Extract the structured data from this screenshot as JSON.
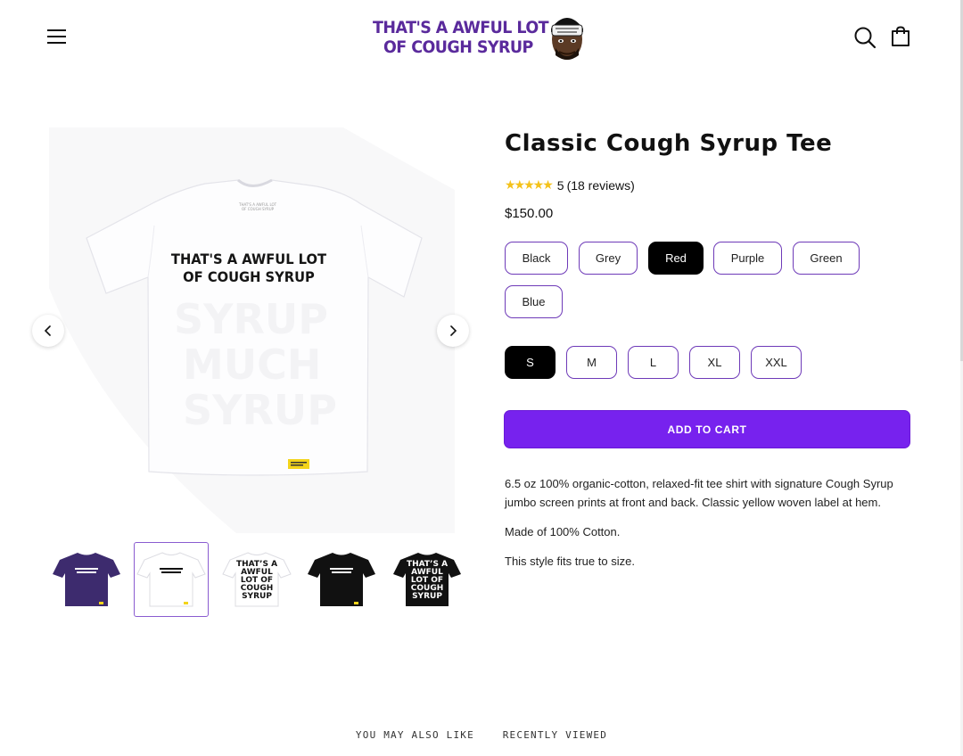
{
  "header": {
    "logo_line1": "THAT'S A AWFUL LOT",
    "logo_line2": "OF COUGH SYRUP"
  },
  "icons": {
    "menu": "hamburger-menu-icon",
    "search": "search-icon",
    "cart": "shopping-bag-icon",
    "prev": "chevron-left-icon",
    "next": "chevron-right-icon",
    "star": "star-icon"
  },
  "gallery": {
    "shirt_line1": "THAT'S A AWFUL LOT",
    "shirt_line2": "OF COUGH SYRUP",
    "active_thumbnail": 1,
    "thumbnails": [
      {
        "shirt": "#3d2b6e",
        "style": "small-logo"
      },
      {
        "shirt": "#ffffff",
        "style": "small-logo"
      },
      {
        "shirt": "#ffffff",
        "style": "jumbo-back"
      },
      {
        "shirt": "#111111",
        "style": "small-logo"
      },
      {
        "shirt": "#111111",
        "style": "jumbo-back"
      }
    ]
  },
  "product": {
    "title": "Classic Cough Syrup Tee",
    "rating": "5",
    "review_count": "(18 reviews)",
    "price": "$150.00",
    "colors": [
      "Black",
      "Grey",
      "Red",
      "Purple",
      "Green",
      "Blue"
    ],
    "selected_color": "Red",
    "sizes": [
      "S",
      "M",
      "L",
      "XL",
      "XXL"
    ],
    "selected_size": "S",
    "add_to_cart": "ADD TO CART",
    "description": [
      "6.5 oz 100% organic-cotton, relaxed-fit tee shirt with signature Cough Syrup jumbo screen prints at front and back. Classic yellow woven label at hem.",
      "Made of 100% Cotton.",
      "This style fits true to size."
    ]
  },
  "tabs": [
    "YOU MAY ALSO LIKE",
    "RECENTLY VIEWED"
  ],
  "colors": {
    "accent": "#7722ee",
    "option_border": "#6e3ab8",
    "logo": "#5a2a9c",
    "star": "#f4c21b"
  }
}
